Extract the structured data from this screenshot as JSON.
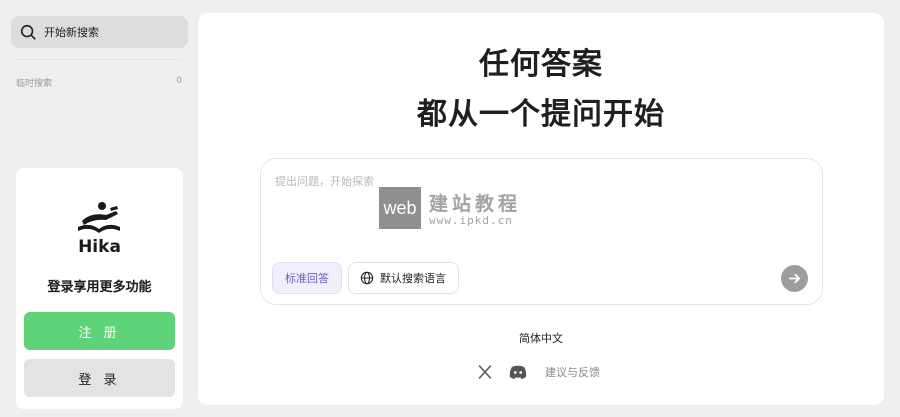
{
  "sidebar": {
    "new_search": {
      "label": "开始新搜索",
      "icon": "search-icon"
    },
    "temp_search": {
      "label": "临时搜索",
      "count": "0"
    },
    "login_card": {
      "logo_icon": "hika-reader-logo",
      "brand": "Hika",
      "promo": "登录享用更多功能",
      "register_label": "注 册",
      "login_label": "登 录"
    }
  },
  "main": {
    "headline_line1": "任何答案",
    "headline_line2": "都从一个提问开始",
    "query": {
      "placeholder": "提出问题，开始探索",
      "value": "",
      "mode_label": "标准回答",
      "language_label": "默认搜索语言",
      "language_icon": "globe-icon",
      "send_icon": "arrow-right-icon"
    },
    "watermark": {
      "box_text": "web",
      "text_cn": "建站教程",
      "url": "www.ipkd.cn"
    },
    "language_switch": "简体中文",
    "footer": {
      "x_icon": "x-icon",
      "discord_icon": "discord-icon",
      "feedback": "建议与反馈"
    }
  },
  "colors": {
    "page_bg": "#f0efed",
    "panel_bg": "#ffffff",
    "register_green": "#5fd37a",
    "chip_purple": "#6a5fc1",
    "send_gray": "#9d9d9d"
  }
}
